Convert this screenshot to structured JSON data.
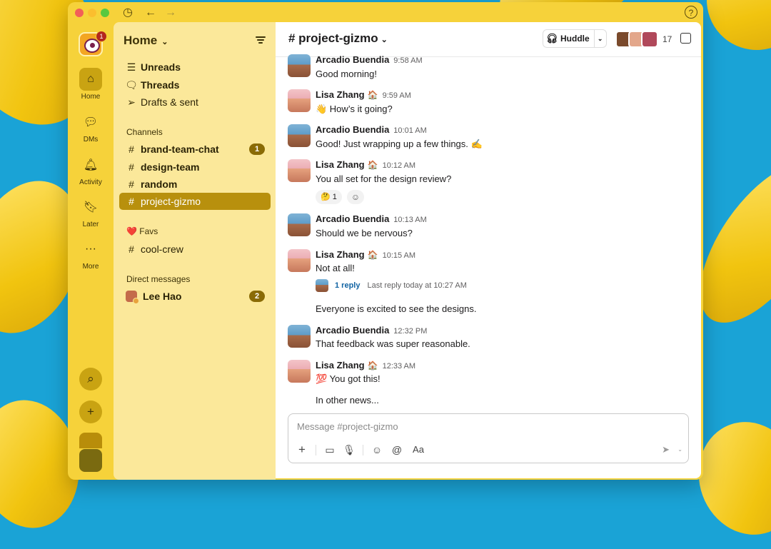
{
  "app": {
    "workspace_badge": "1"
  },
  "rail": {
    "items": [
      {
        "label": "Home",
        "icon": "home-icon"
      },
      {
        "label": "DMs",
        "icon": "dms-icon"
      },
      {
        "label": "Activity",
        "icon": "bell-icon"
      },
      {
        "label": "Later",
        "icon": "bookmark-icon"
      },
      {
        "label": "More",
        "icon": "more-icon"
      }
    ]
  },
  "sidebar": {
    "title": "Home",
    "top_items": [
      {
        "label": "Unreads",
        "icon": "unreads-icon",
        "bold": true
      },
      {
        "label": "Threads",
        "icon": "threads-icon",
        "bold": true
      },
      {
        "label": "Drafts & sent",
        "icon": "send-icon",
        "bold": false
      }
    ],
    "channels_header": "Channels",
    "channels": [
      {
        "name": "brand-team-chat",
        "bold": true,
        "badge": "1",
        "active": false
      },
      {
        "name": "design-team",
        "bold": true,
        "badge": "",
        "active": false
      },
      {
        "name": "random",
        "bold": true,
        "badge": "",
        "active": false
      },
      {
        "name": "project-gizmo",
        "bold": false,
        "badge": "",
        "active": true
      }
    ],
    "favs_header": "❤️ Favs",
    "favs": [
      {
        "name": "cool-crew"
      }
    ],
    "dms_header": "Direct messages",
    "dms": [
      {
        "name": "Lee Hao",
        "badge": "2"
      }
    ]
  },
  "channel": {
    "title": "# project-gizmo",
    "huddle_label": "Huddle",
    "member_count": "17"
  },
  "messages": [
    {
      "author": "Arcadio Buendia",
      "emoji": "",
      "time": "9:58 AM",
      "text": "Good morning!"
    },
    {
      "author": "Lisa Zhang",
      "emoji": "🏠",
      "time": "9:59 AM",
      "text": "👋 How’s it going?"
    },
    {
      "author": "Arcadio Buendia",
      "emoji": "",
      "time": "10:01 AM",
      "text": "Good! Just wrapping up a few things. ✍️"
    },
    {
      "author": "Lisa Zhang",
      "emoji": "🏠",
      "time": "10:12 AM",
      "text": "You all set for the design review?",
      "reaction": "🤔 1"
    },
    {
      "author": "Arcadio Buendia",
      "emoji": "",
      "time": "10:13 AM",
      "text": "Should we be nervous?"
    },
    {
      "author": "Lisa Zhang",
      "emoji": "🏠",
      "time": "10:15 AM",
      "text": "Not at all!",
      "thread_reply": "1 reply",
      "thread_last": "Last reply today at 10:27 AM",
      "followup": "Everyone is excited to see the designs."
    },
    {
      "author": "Arcadio Buendia",
      "emoji": "",
      "time": "12:32 PM",
      "text": "That feedback was super reasonable."
    },
    {
      "author": "Lisa Zhang",
      "emoji": "🏠",
      "time": "12:33 AM",
      "text": "💯 You got this!",
      "followup": "In other news..."
    }
  ],
  "composer": {
    "placeholder": "Message #project-gizmo",
    "format_label": "Aa"
  }
}
